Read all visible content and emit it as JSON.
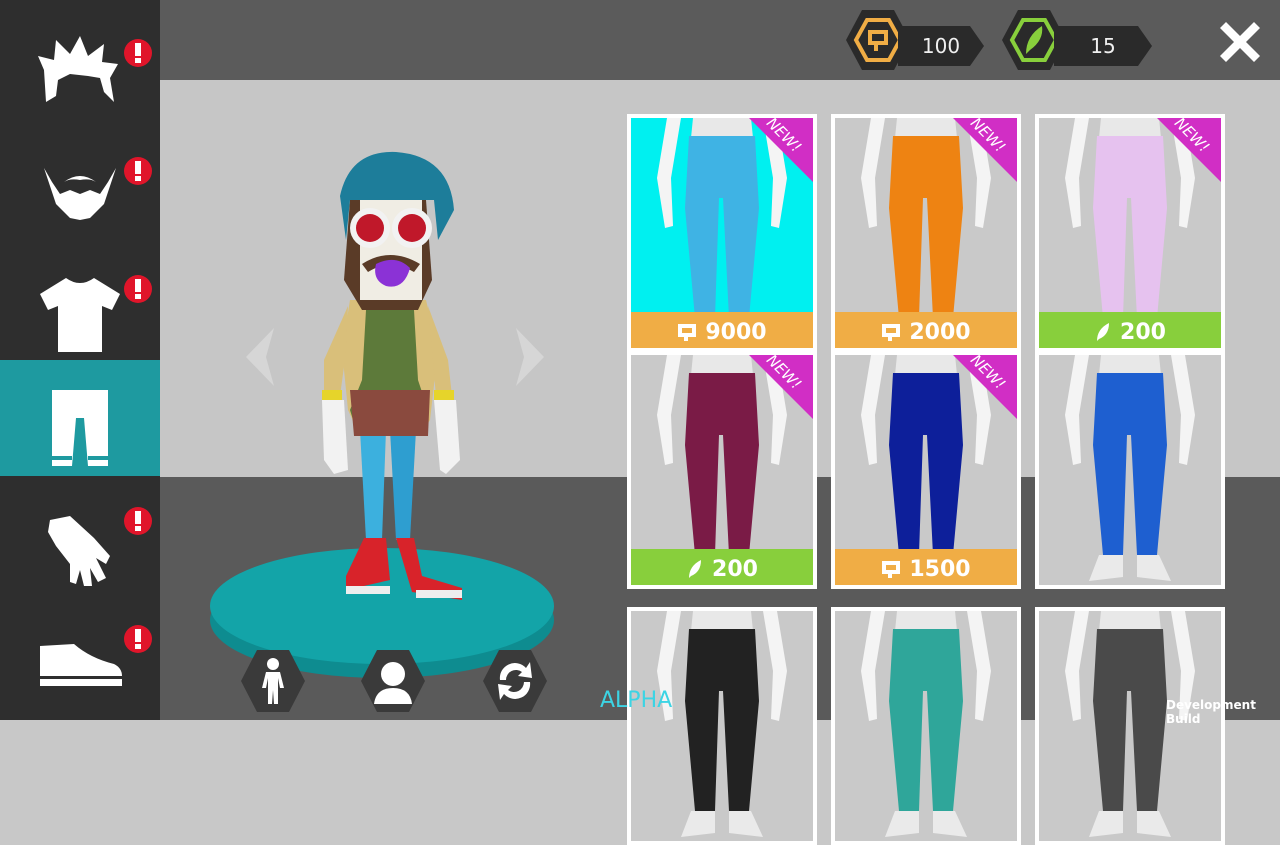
{
  "currency": {
    "coins": {
      "icon": "coin-screen-icon",
      "value": "100"
    },
    "gems": {
      "icon": "green-feather-icon",
      "value": "15"
    }
  },
  "sidebar": {
    "categories": [
      {
        "name": "hair",
        "icon": "hair-icon",
        "alert": "!"
      },
      {
        "name": "beard",
        "icon": "beard-icon",
        "alert": "!"
      },
      {
        "name": "shirt",
        "icon": "shirt-icon",
        "alert": "!"
      },
      {
        "name": "pants",
        "icon": "pants-icon",
        "alert": "",
        "active": true
      },
      {
        "name": "gloves",
        "icon": "glove-icon",
        "alert": "!"
      },
      {
        "name": "shoes",
        "icon": "shoe-icon",
        "alert": "!"
      }
    ]
  },
  "preview": {
    "prev_arrow": "‹",
    "next_arrow": "›"
  },
  "items": [
    {
      "badge": "NEW!",
      "price": "9000",
      "currency": "coins",
      "color": "#3fb3e4"
    },
    {
      "badge": "NEW!",
      "price": "2000",
      "currency": "coins",
      "color": "#ee8312"
    },
    {
      "badge": "NEW!",
      "price": "200",
      "currency": "feathers",
      "color": "#e6c2ef"
    },
    {
      "badge": "NEW!",
      "price": "200",
      "currency": "feathers",
      "color": "#7a1b46"
    },
    {
      "badge": "NEW!",
      "price": "1500",
      "currency": "coins",
      "color": "#0d1f9a"
    },
    {
      "badge": "",
      "price": "",
      "currency": "",
      "color": "#1e5fd0"
    },
    {
      "badge": "",
      "price": "",
      "currency": "",
      "color": "#222222"
    },
    {
      "badge": "",
      "price": "",
      "currency": "",
      "color": "#2fa69a"
    },
    {
      "badge": "",
      "price": "",
      "currency": "",
      "color": "#4a4a4a"
    }
  ],
  "footer": {
    "alpha": "ALPHA",
    "build": "Development Build"
  },
  "colors": {
    "accent_teal": "#1e9aa0",
    "price_gold": "#f0ad45",
    "price_green": "#88cf3c",
    "new_badge": "#d12ec5",
    "alert_red": "#e0152a"
  }
}
